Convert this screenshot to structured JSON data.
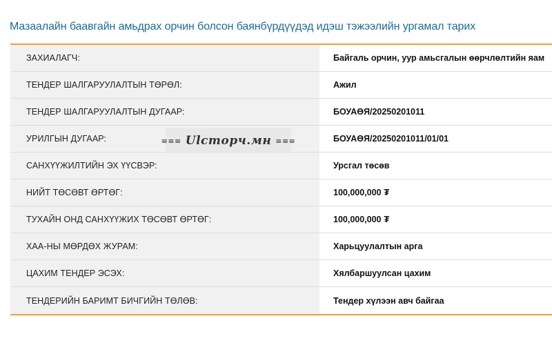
{
  "page": {
    "title": "Мазаалайн баавгайн амьдрах орчин болсон баянбүрдүүдэд идэш тэжээлийн ургамал тарих"
  },
  "details": [
    {
      "label": "ЗАХИАЛАГЧ:",
      "value": "Байгаль орчин, уур амьсгалын өөрчлөлтийн яам"
    },
    {
      "label": "ТЕНДЕР ШАЛГАРУУЛАЛТЫН ТӨРӨЛ:",
      "value": "Ажил"
    },
    {
      "label": "ТЕНДЕР ШАЛГАРУУЛАЛТЫН ДУГААР:",
      "value": "БОУАӨЯ/20250201011"
    },
    {
      "label": "УРИЛГЫН ДУГААР:",
      "value": "БОУАӨЯ/20250201011/01/01"
    },
    {
      "label": "САНХҮҮЖИЛТИЙН ЭХ ҮҮСВЭР:",
      "value": "Урсгал төсөв"
    },
    {
      "label": "НИЙТ ТӨСӨВТ ӨРТӨГ:",
      "value": "100,000,000",
      "currency": "₮"
    },
    {
      "label": "ТУХАЙН ОНД САНХҮҮЖИХ ТӨСӨВТ ӨРТӨГ:",
      "value": "100,000,000",
      "currency": "₮"
    },
    {
      "label": "ХАА-НЫ МӨРДӨХ ЖУРАМ:",
      "value": "Харьцуулалтын арга"
    },
    {
      "label": "ЦАХИМ ТЕНДЕР ЭСЭХ:",
      "value": "Хялбаршуулсан цахим"
    },
    {
      "label": "ТЕНДЕРИЙН БАРИМТ БИЧГИЙН ТӨЛӨВ:",
      "value": "Тендер хүлээн авч байгаа"
    }
  ],
  "watermark": {
    "text": "Ulcmopч.мн",
    "bars": "≡≡≡"
  },
  "colors": {
    "title": "#1e6a96",
    "accent_border": "#f0a030",
    "label_bg": "#f1f1f1"
  }
}
